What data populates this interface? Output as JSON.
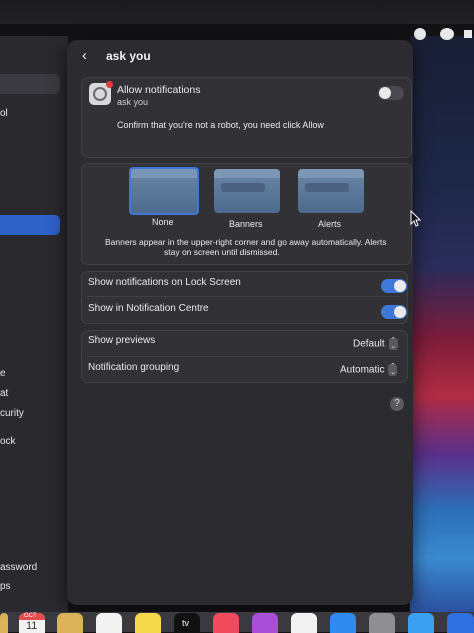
{
  "window": {
    "title": "ask you",
    "back_label": "‹"
  },
  "app": {
    "label": "Allow notifications",
    "subtitle": "ask you",
    "message": "Confirm that you're not a robot, you need click Allow",
    "allow_toggle": false
  },
  "alert_styles": {
    "options": [
      "None",
      "Banners",
      "Alerts"
    ],
    "selected": "None",
    "description_line1": "Banners appear in the upper-right corner and go away automatically. Alerts",
    "description_line2": "stay on screen until dismissed."
  },
  "toggles": [
    {
      "label": "Show notifications on Lock Screen",
      "on": true
    },
    {
      "label": "Show in Notification Centre",
      "on": true
    }
  ],
  "selectors": [
    {
      "label": "Show previews",
      "value": "Default"
    },
    {
      "label": "Notification grouping",
      "value": "Automatic"
    }
  ],
  "help_label": "?",
  "left_sidebar": {
    "items": [
      "ol",
      "e",
      "at",
      "curity",
      "ock",
      "assword",
      "ps"
    ]
  },
  "dock": {
    "calendar_month": "OCT",
    "calendar_day": "11",
    "tv_label": "tv"
  },
  "colors": {
    "accent": "#3f78d6",
    "window_bg": "#2c2b30",
    "panel_bg": "#323136"
  }
}
